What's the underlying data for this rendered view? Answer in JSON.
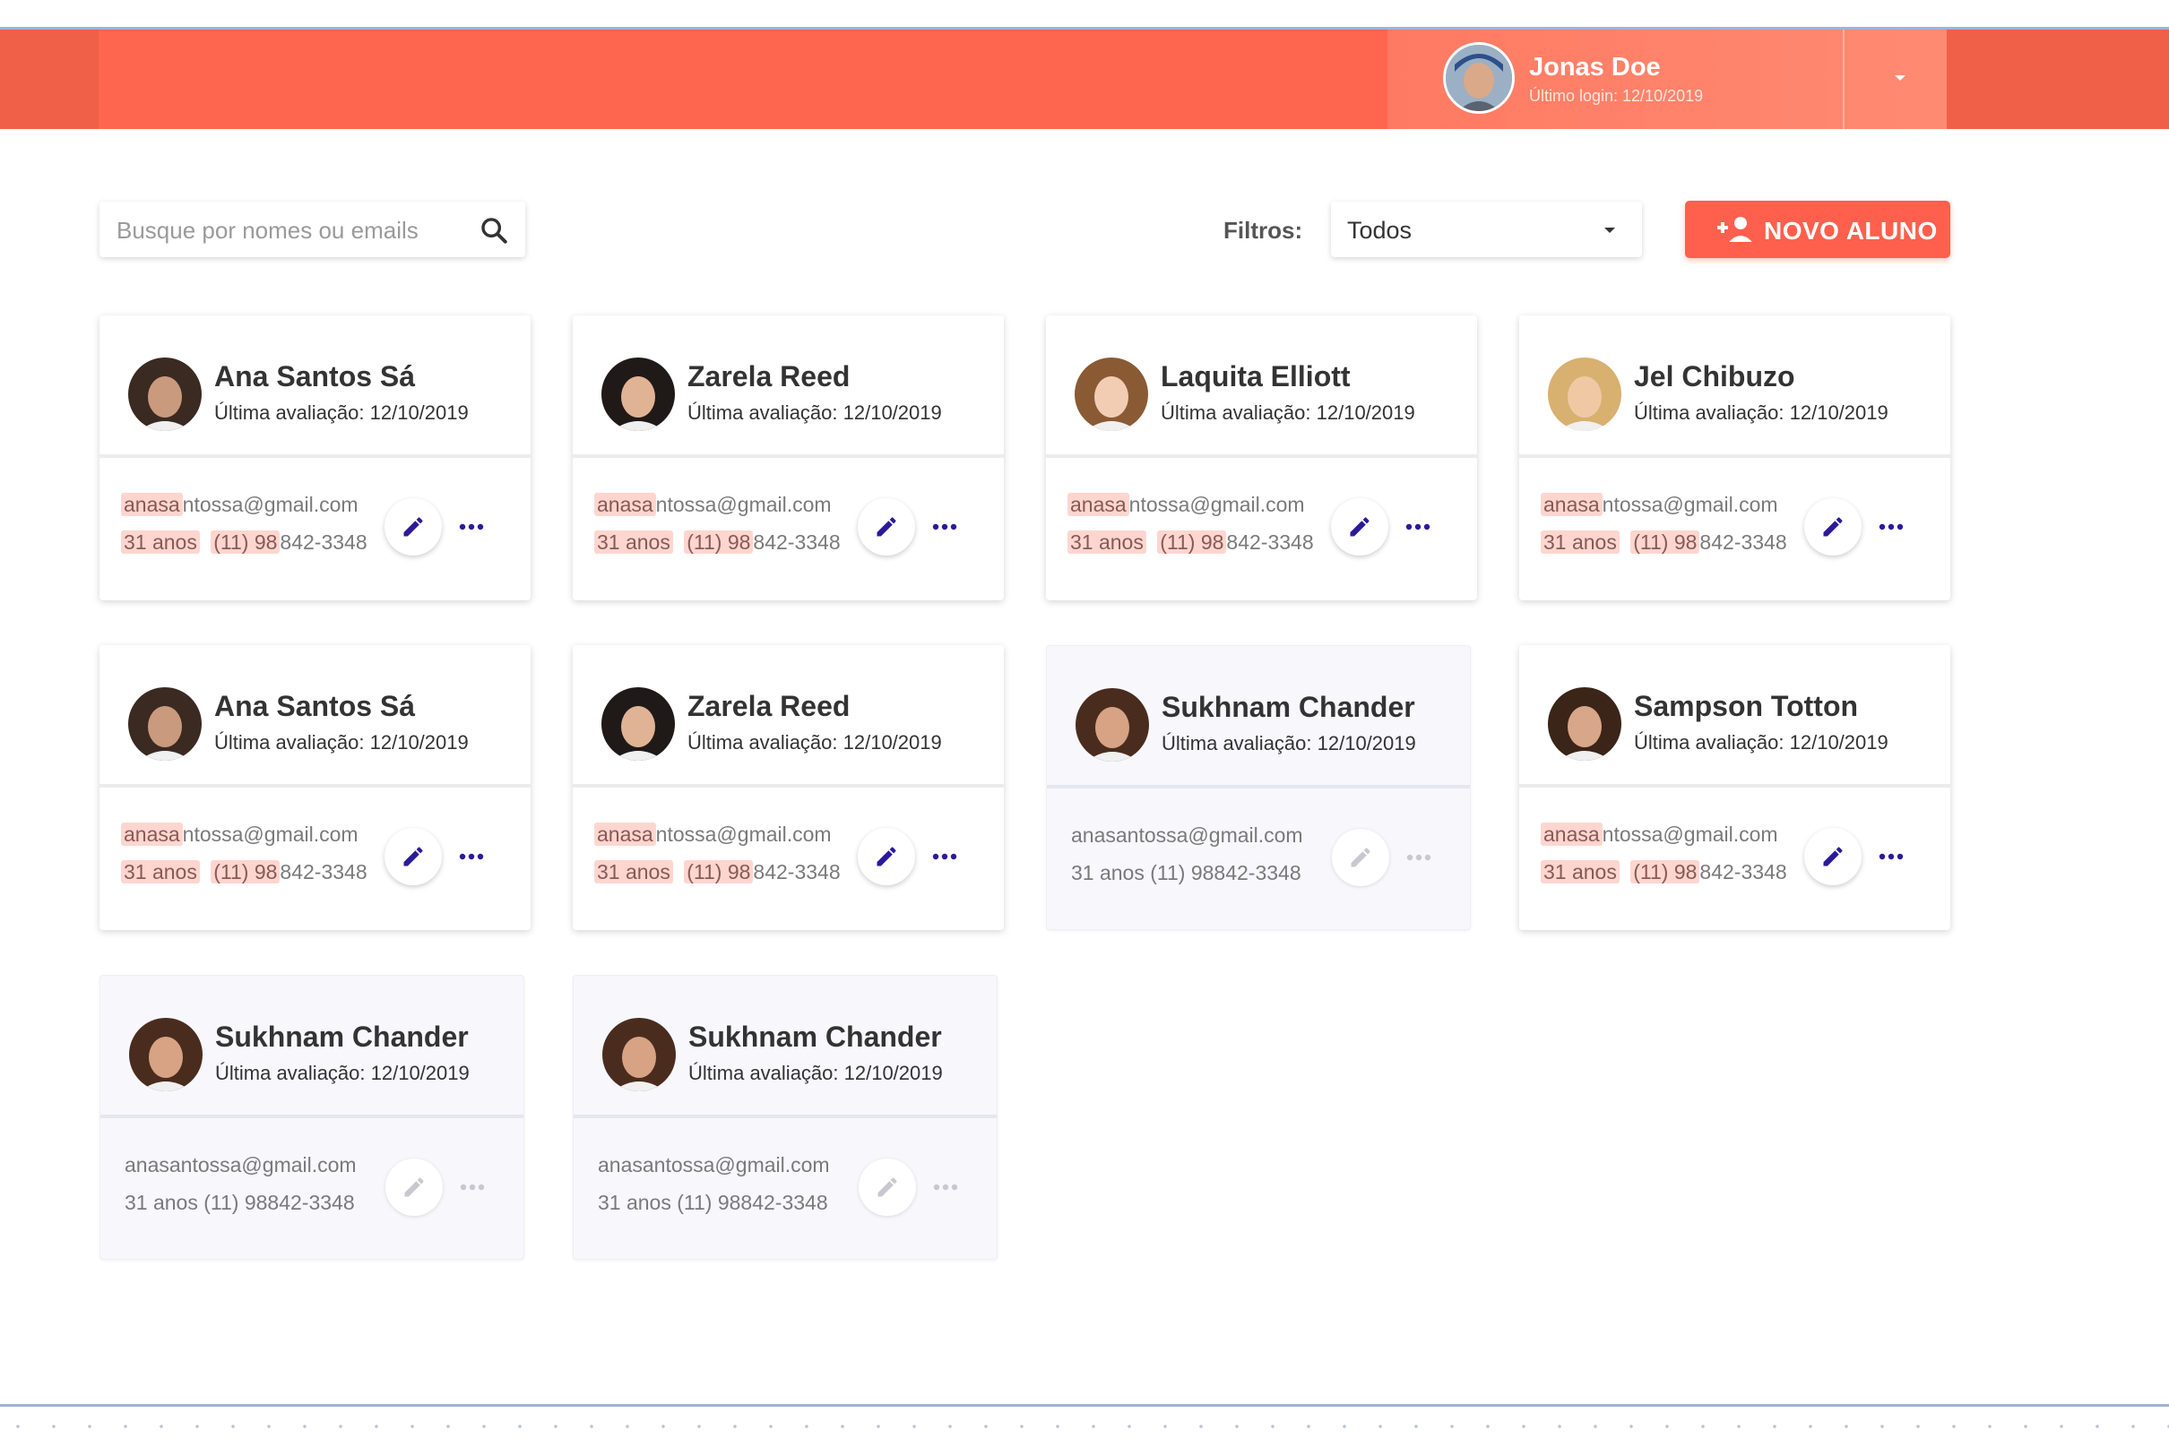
{
  "header": {
    "user_name": "Jonas Doe",
    "user_last_login": "Último login: 12/10/2019",
    "accent_color": "#ff6650"
  },
  "toolbar": {
    "search_placeholder": "Busque por nomes ou emails",
    "filter_label": "Filtros:",
    "filter_value": "Todos",
    "new_button_label": "NOVO ALUNO"
  },
  "students": [
    {
      "name": "Ana Santos Sá",
      "last_eval": "Última avaliação: 12/10/2019",
      "email_hl": "anasa",
      "email_rest": "ntossa@gmail.com",
      "age": "31 anos",
      "phone_hl": "(11) 98",
      "phone_rest": "842-3348",
      "active": true
    },
    {
      "name": "Zarela Reed",
      "last_eval": "Última avaliação: 12/10/2019",
      "email_hl": "anasa",
      "email_rest": "ntossa@gmail.com",
      "age": "31 anos",
      "phone_hl": "(11) 98",
      "phone_rest": "842-3348",
      "active": true
    },
    {
      "name": "Laquita Elliott",
      "last_eval": "Última avaliação: 12/10/2019",
      "email_hl": "anasa",
      "email_rest": "ntossa@gmail.com",
      "age": "31 anos",
      "phone_hl": "(11) 98",
      "phone_rest": "842-3348",
      "active": true
    },
    {
      "name": "Jel Chibuzo",
      "last_eval": "Última avaliação: 12/10/2019",
      "email_hl": "anasa",
      "email_rest": "ntossa@gmail.com",
      "age": "31 anos",
      "phone_hl": "(11) 98",
      "phone_rest": "842-3348",
      "active": true
    },
    {
      "name": "Ana Santos Sá",
      "last_eval": "Última avaliação: 12/10/2019",
      "email_hl": "anasa",
      "email_rest": "ntossa@gmail.com",
      "age": "31 anos",
      "phone_hl": "(11) 98",
      "phone_rest": "842-3348",
      "active": true
    },
    {
      "name": "Zarela Reed",
      "last_eval": "Última avaliação: 12/10/2019",
      "email_hl": "anasa",
      "email_rest": "ntossa@gmail.com",
      "age": "31 anos",
      "phone_hl": "(11) 98",
      "phone_rest": "842-3348",
      "active": true
    },
    {
      "name": "Sukhnam Chander",
      "last_eval": "Última avaliação: 12/10/2019",
      "email": "anasantossa@gmail.com",
      "age": "31 anos",
      "phone": "(11) 98842-3348",
      "active": false
    },
    {
      "name": "Sampson Totton",
      "last_eval": "Última avaliação: 12/10/2019",
      "email_hl": "anasa",
      "email_rest": "ntossa@gmail.com",
      "age": "31 anos",
      "phone_hl": "(11) 98",
      "phone_rest": "842-3348",
      "active": true
    },
    {
      "name": "Sukhnam Chander",
      "last_eval": "Última avaliação: 12/10/2019",
      "email": "anasantossa@gmail.com",
      "age": "31 anos",
      "phone": "(11) 98842-3348",
      "active": false
    },
    {
      "name": "Sukhnam Chander",
      "last_eval": "Última avaliação: 12/10/2019",
      "email": "anasantossa@gmail.com",
      "age": "31 anos",
      "phone": "(11) 98842-3348",
      "active": false
    }
  ],
  "colors": {
    "action_active": "#2a1a9a",
    "action_inactive": "#c8c8d0",
    "highlight": "#ffd6cf"
  }
}
